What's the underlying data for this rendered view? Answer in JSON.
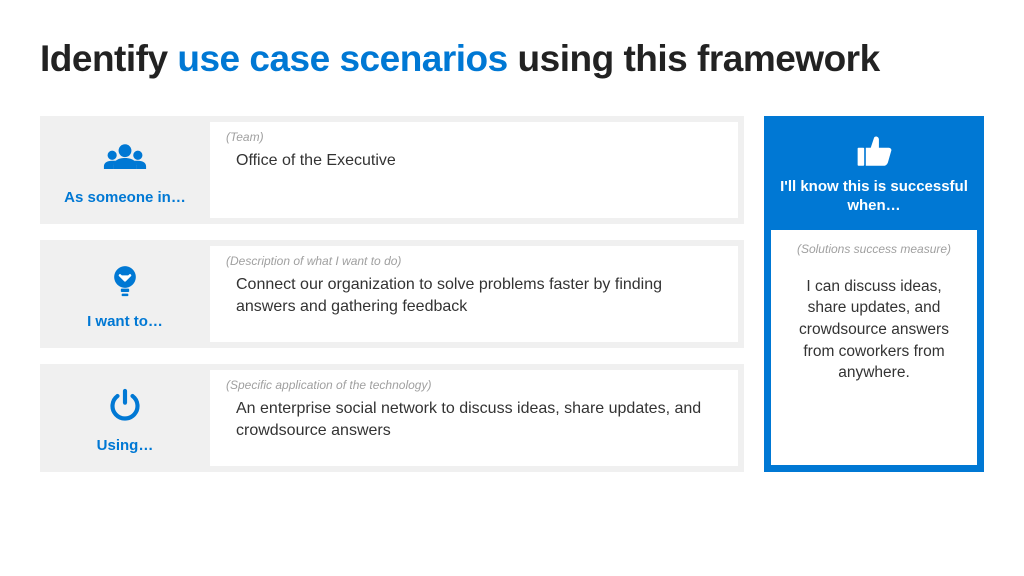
{
  "title": {
    "part1": "Identify ",
    "accent": "use case scenarios",
    "part2": " using this framework"
  },
  "rows": [
    {
      "label": "As someone in…",
      "hint": "(Team)",
      "value": "Office of the Executive"
    },
    {
      "label": "I want to…",
      "hint": "(Description of what I want to do)",
      "value": "Connect our organization to solve problems faster by finding answers and gathering feedback"
    },
    {
      "label": "Using…",
      "hint": "(Specific application of the technology)",
      "value": "An enterprise social network to discuss ideas, share updates, and crowdsource answers"
    }
  ],
  "success": {
    "label": "I'll know this is successful when…",
    "hint": "(Solutions success measure)",
    "value": "I can discuss ideas, share updates, and crowdsource answers from coworkers from anywhere."
  }
}
